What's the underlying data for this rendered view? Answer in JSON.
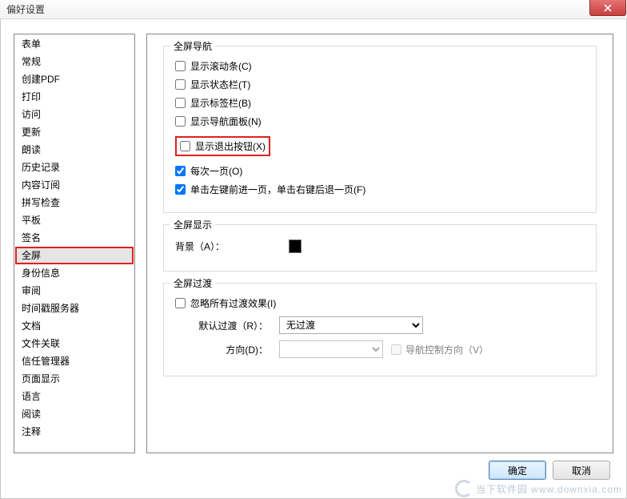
{
  "window": {
    "title": "偏好设置",
    "close": "X"
  },
  "sidebar": {
    "items": [
      "表单",
      "常规",
      "创建PDF",
      "打印",
      "访问",
      "更新",
      "朗读",
      "历史记录",
      "内容订阅",
      "拼写检查",
      "平板",
      "签名",
      "全屏",
      "身份信息",
      "审阅",
      "时间戳服务器",
      "文档",
      "文件关联",
      "信任管理器",
      "页面显示",
      "语言",
      "阅读",
      "注释"
    ],
    "selected": "全屏"
  },
  "groups": {
    "nav": {
      "title": "全屏导航",
      "opts": {
        "show_scroll": {
          "label": "显示滚动条(C)",
          "checked": false
        },
        "show_status": {
          "label": "显示状态栏(T)",
          "checked": false
        },
        "show_tabs": {
          "label": "显示标签栏(B)",
          "checked": false
        },
        "show_navpanel": {
          "label": "显示导航面板(N)",
          "checked": false
        },
        "show_exit": {
          "label": "显示退出按钮(X)",
          "checked": false
        },
        "one_per": {
          "label": "每次一页(O)",
          "checked": true
        },
        "click_nav": {
          "label": "单击左键前进一页，单击右键后退一页(F)",
          "checked": true
        }
      }
    },
    "display": {
      "title": "全屏显示",
      "bg_label": "背景（A）：",
      "bg_color": "#000000"
    },
    "transition": {
      "title": "全屏过渡",
      "ignore_all": {
        "label": "忽略所有过渡效果(I)",
        "checked": false
      },
      "default_label": "默认过渡（R）：",
      "default_value": "无过渡",
      "direction_label": "方向(D)：",
      "direction_value": "",
      "nav_ctrl": {
        "label": "导航控制方向（V）",
        "checked": false
      }
    }
  },
  "footer": {
    "ok": "确定",
    "cancel": "取消"
  },
  "watermark": "当下软件园  www.downxia.com"
}
